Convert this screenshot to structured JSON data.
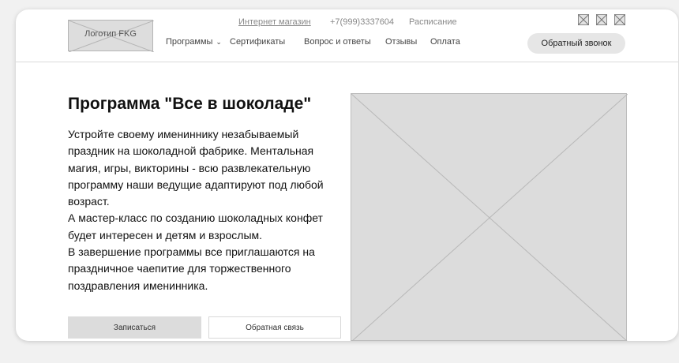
{
  "header": {
    "logo_text": "Логотип FKG",
    "top_links": {
      "shop": "Интернет магазин",
      "phone": "+7(999)3337604",
      "schedule": "Расписание"
    },
    "nav": {
      "programs": "Программы",
      "certificates": "Сертификаты",
      "faq": "Вопрос и ответы",
      "reviews": "Отзывы",
      "payment": "Оплата"
    },
    "callback_label": "Обратный звонок",
    "social_icons": [
      "placeholder-icon",
      "placeholder-icon",
      "placeholder-icon"
    ]
  },
  "main": {
    "title": "Программа \"Все в шоколаде\"",
    "paragraphs": [
      "Устройте своему имениннику незабываемый праздник на шоколадной фабрике. Ментальная магия, игры, викторины - всю развлекательную программу наши ведущие адаптируют под любой возраст.",
      "А мастер-класс по созданию шоколадных конфет будет интересен и детям и взрослым.",
      "В завершение программы все приглашаются на праздничное чаепитие для торжественного поздравления именинника."
    ],
    "signup_label": "Записаться",
    "feedback_label": "Обратная связь"
  },
  "colors": {
    "page_background": "#f1f1f1",
    "card_background": "#ffffff",
    "placeholder_fill": "#dcdcdc",
    "callback_fill": "#e6e6e6",
    "text": "#111111",
    "muted_text": "#888888"
  }
}
